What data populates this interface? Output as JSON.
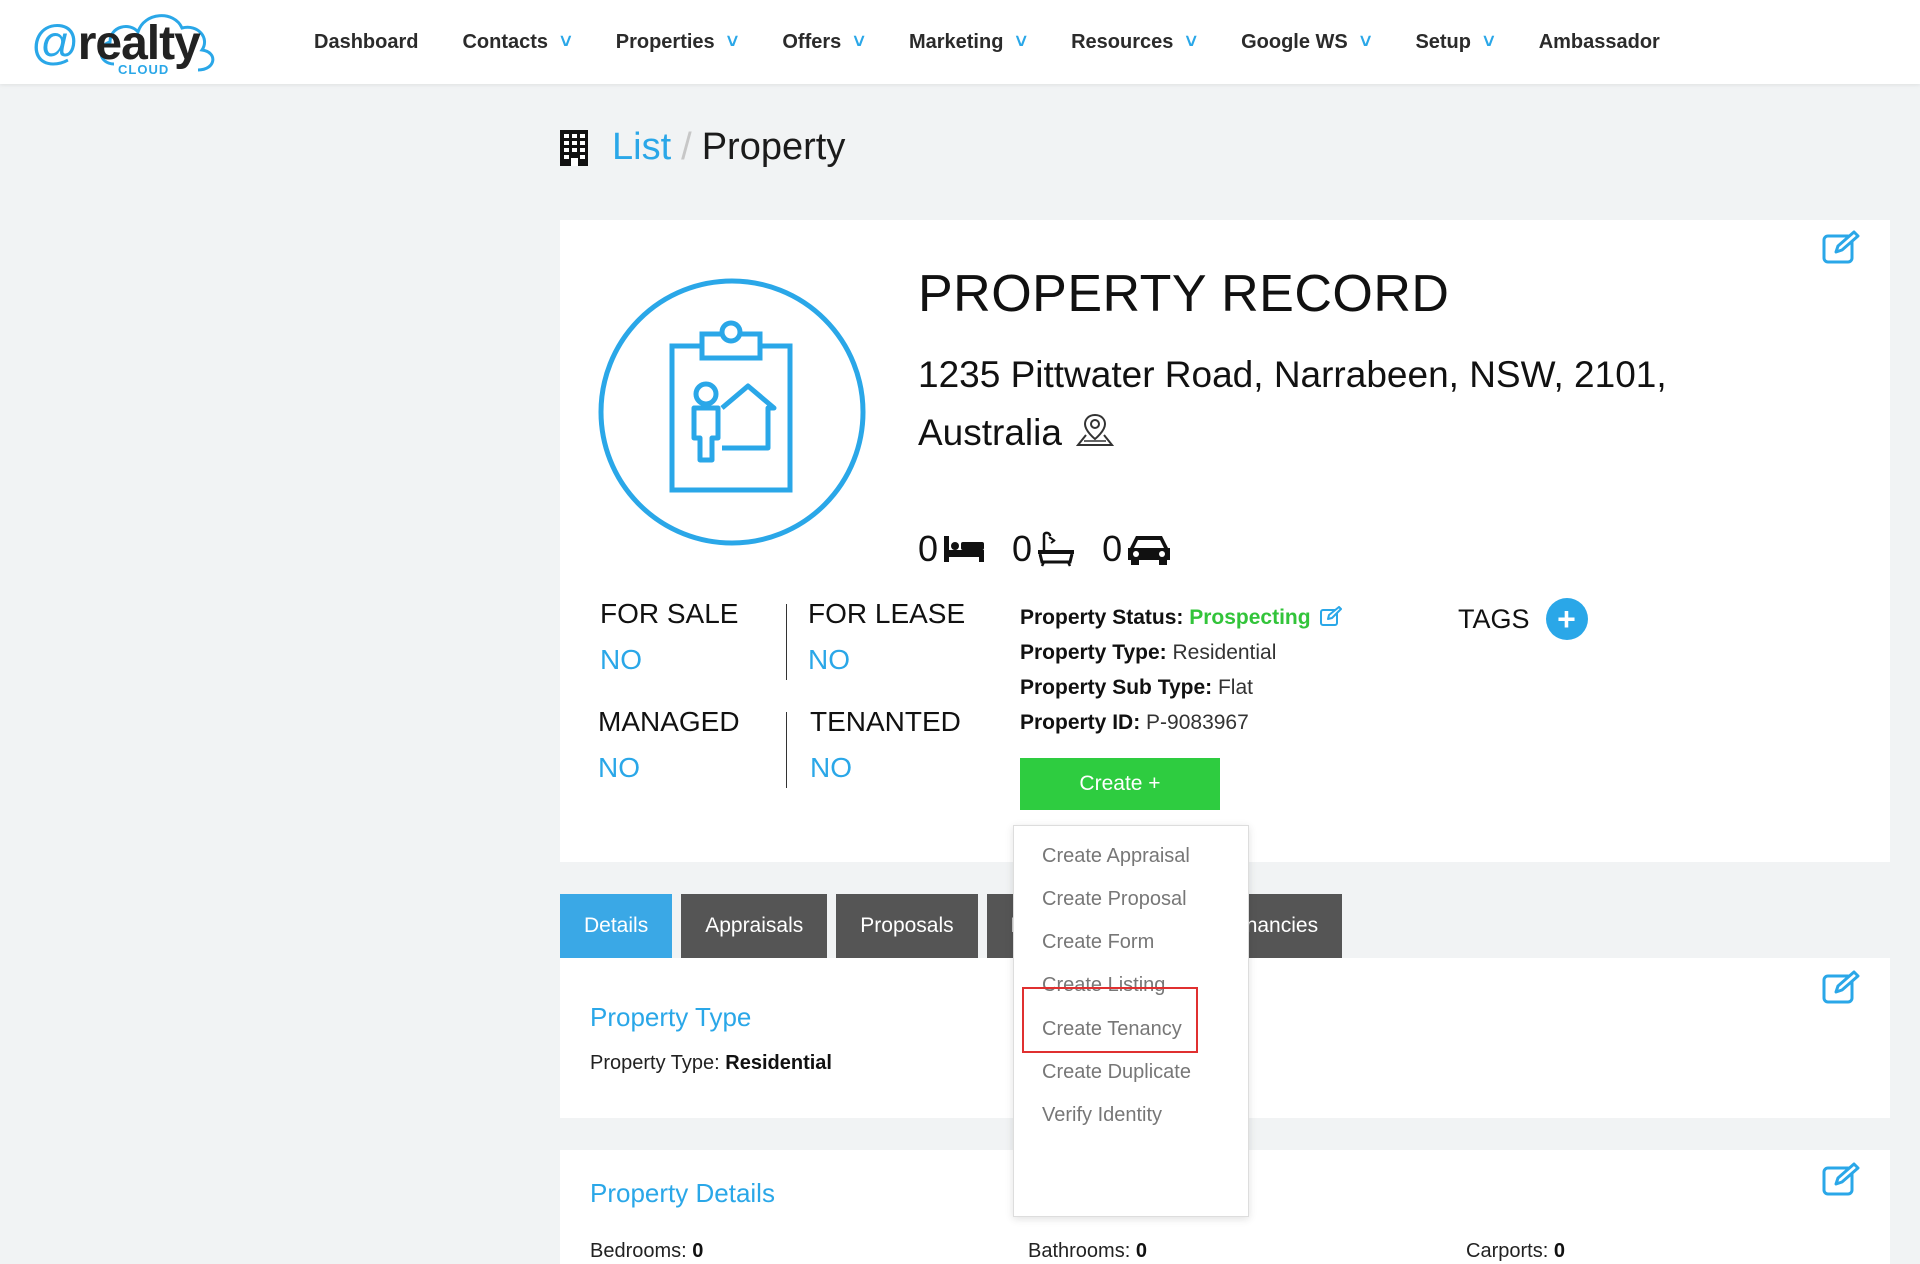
{
  "logo": {
    "prefix": "@",
    "brand": "realty",
    "sub": "CLOUD"
  },
  "nav": [
    {
      "label": "Dashboard",
      "dropdown": false
    },
    {
      "label": "Contacts",
      "dropdown": true
    },
    {
      "label": "Properties",
      "dropdown": true
    },
    {
      "label": "Offers",
      "dropdown": true
    },
    {
      "label": "Marketing",
      "dropdown": true
    },
    {
      "label": "Resources",
      "dropdown": true
    },
    {
      "label": "Google WS",
      "dropdown": true
    },
    {
      "label": "Setup",
      "dropdown": true
    },
    {
      "label": "Ambassador",
      "dropdown": false
    }
  ],
  "breadcrumb": {
    "link": "List",
    "separator": "/",
    "current": "Property"
  },
  "record": {
    "title": "PROPERTY RECORD",
    "address_line1": "1235 Pittwater Road, Narrabeen, NSW, 2101,",
    "address_line2": "Australia",
    "bedrooms": "0",
    "bathrooms": "0",
    "carports": "0"
  },
  "flags": {
    "for_sale": {
      "label": "FOR SALE",
      "value": "NO"
    },
    "for_lease": {
      "label": "FOR LEASE",
      "value": "NO"
    },
    "managed": {
      "label": "MANAGED",
      "value": "NO"
    },
    "tenanted": {
      "label": "TENANTED",
      "value": "NO"
    }
  },
  "properties": {
    "status_label": "Property Status:",
    "status_value": "Prospecting",
    "type_label": "Property Type:",
    "type_value": "Residential",
    "subtype_label": "Property Sub Type:",
    "subtype_value": "Flat",
    "id_label": "Property ID:",
    "id_value": "P-9083967"
  },
  "create_button": "Create +",
  "tags_label": "TAGS",
  "tabs": [
    {
      "label": "Details",
      "active": true
    },
    {
      "label": "Appraisals",
      "active": false
    },
    {
      "label": "Proposals",
      "active": false
    },
    {
      "label": "Lis",
      "active": false
    },
    {
      "label": "",
      "active": false
    },
    {
      "label": "Tenancies",
      "active": false
    }
  ],
  "dropdown": [
    "Create Appraisal",
    "Create Proposal",
    "Create Form",
    "Create Listing",
    "Create Tenancy",
    "Create Duplicate",
    "Verify Identity"
  ],
  "section_type": {
    "title": "Property Type",
    "label": "Property Type:",
    "value": "Residential"
  },
  "section_details": {
    "title": "Property Details",
    "bedrooms_label": "Bedrooms:",
    "bedrooms_value": "0",
    "bathrooms_label": "Bathrooms:",
    "bathrooms_value": "0",
    "carports_label": "Carports:",
    "carports_value": "0"
  },
  "colors": {
    "accent": "#2aa7e8",
    "success": "#2ecc40",
    "tab_dark": "#555555",
    "highlight": "#e03030"
  }
}
